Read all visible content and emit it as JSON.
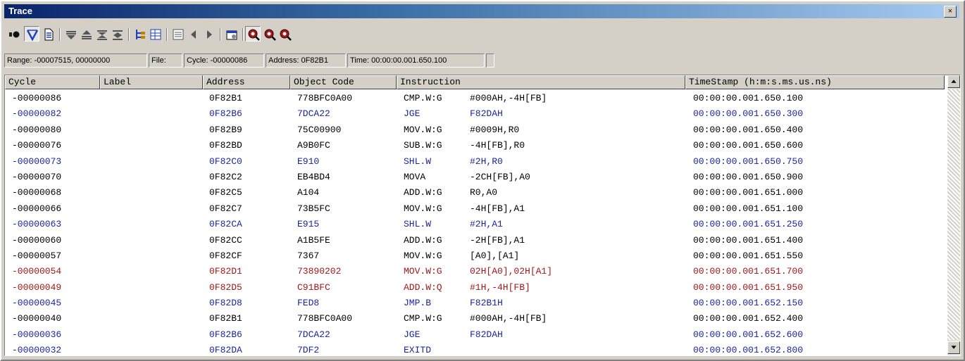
{
  "window": {
    "title": "Trace",
    "close_glyph": "×"
  },
  "toolbar": {
    "buttons": [
      {
        "name": "record-icon"
      },
      {
        "name": "filter-icon"
      },
      {
        "name": "document-icon"
      },
      {
        "name": "step-down-icon"
      },
      {
        "name": "step-up-icon"
      },
      {
        "name": "collapse-icon"
      },
      {
        "name": "expand-icon"
      },
      {
        "name": "tree-icon"
      },
      {
        "name": "grid-icon"
      },
      {
        "name": "window-icon"
      },
      {
        "name": "left-arrow-icon"
      },
      {
        "name": "right-arrow-icon"
      },
      {
        "name": "settings-icon"
      },
      {
        "name": "zoom-in-icon"
      },
      {
        "name": "zoom-out-icon"
      },
      {
        "name": "zoom-reset-icon"
      }
    ]
  },
  "status": {
    "range": "Range: -00007515, 00000000",
    "file": "File:",
    "cycle": "Cycle: -00000086",
    "address": "Address: 0F82B1",
    "time": "Time: 00:00:00.001.650.100"
  },
  "columns": {
    "cycle": "Cycle",
    "label": "Label",
    "address": "Address",
    "object_code": "Object Code",
    "instruction": "Instruction",
    "timestamp": "TimeStamp (h:m:s.ms.us.ns)"
  },
  "colors": {
    "normal": "#000000",
    "blue": "#1a24a0",
    "red": "#a01818"
  },
  "rows": [
    {
      "cycle": "-00000086",
      "label": "",
      "address": "0F82B1",
      "code": "778BFC0A00",
      "mnemonic": "CMP.W:G",
      "operand": "#000AH,-4H[FB]",
      "ts": "00:00:00.001.650.100",
      "color": "black"
    },
    {
      "cycle": "-00000082",
      "label": "",
      "address": "0F82B6",
      "code": "7DCA22",
      "mnemonic": "JGE",
      "operand": "F82DAH",
      "ts": "00:00:00.001.650.300",
      "color": "blue"
    },
    {
      "cycle": "-00000080",
      "label": "",
      "address": "0F82B9",
      "code": "75C00900",
      "mnemonic": "MOV.W:G",
      "operand": "#0009H,R0",
      "ts": "00:00:00.001.650.400",
      "color": "black"
    },
    {
      "cycle": "-00000076",
      "label": "",
      "address": "0F82BD",
      "code": "A9B0FC",
      "mnemonic": "SUB.W:G",
      "operand": "-4H[FB],R0",
      "ts": "00:00:00.001.650.600",
      "color": "black"
    },
    {
      "cycle": "-00000073",
      "label": "",
      "address": "0F82C0",
      "code": "E910",
      "mnemonic": "SHL.W",
      "operand": "#2H,R0",
      "ts": "00:00:00.001.650.750",
      "color": "blue"
    },
    {
      "cycle": "-00000070",
      "label": "",
      "address": "0F82C2",
      "code": "EB4BD4",
      "mnemonic": "MOVA",
      "operand": "-2CH[FB],A0",
      "ts": "00:00:00.001.650.900",
      "color": "black"
    },
    {
      "cycle": "-00000068",
      "label": "",
      "address": "0F82C5",
      "code": "A104",
      "mnemonic": "ADD.W:G",
      "operand": "R0,A0",
      "ts": "00:00:00.001.651.000",
      "color": "black"
    },
    {
      "cycle": "-00000066",
      "label": "",
      "address": "0F82C7",
      "code": "73B5FC",
      "mnemonic": "MOV.W:G",
      "operand": "-4H[FB],A1",
      "ts": "00:00:00.001.651.100",
      "color": "black"
    },
    {
      "cycle": "-00000063",
      "label": "",
      "address": "0F82CA",
      "code": "E915",
      "mnemonic": "SHL.W",
      "operand": "#2H,A1",
      "ts": "00:00:00.001.651.250",
      "color": "blue"
    },
    {
      "cycle": "-00000060",
      "label": "",
      "address": "0F82CC",
      "code": "A1B5FE",
      "mnemonic": "ADD.W:G",
      "operand": "-2H[FB],A1",
      "ts": "00:00:00.001.651.400",
      "color": "black"
    },
    {
      "cycle": "-00000057",
      "label": "",
      "address": "0F82CF",
      "code": "7367",
      "mnemonic": "MOV.W:G",
      "operand": "[A0],[A1]",
      "ts": "00:00:00.001.651.550",
      "color": "black"
    },
    {
      "cycle": "-00000054",
      "label": "",
      "address": "0F82D1",
      "code": "73890202",
      "mnemonic": "MOV.W:G",
      "operand": "02H[A0],02H[A1]",
      "ts": "00:00:00.001.651.700",
      "color": "red"
    },
    {
      "cycle": "-00000049",
      "label": "",
      "address": "0F82D5",
      "code": "C91BFC",
      "mnemonic": "ADD.W:Q",
      "operand": "#1H,-4H[FB]",
      "ts": "00:00:00.001.651.950",
      "color": "red"
    },
    {
      "cycle": "-00000045",
      "label": "",
      "address": "0F82D8",
      "code": "FED8",
      "mnemonic": "JMP.B",
      "operand": "F82B1H",
      "ts": "00:00:00.001.652.150",
      "color": "blue"
    },
    {
      "cycle": "-00000040",
      "label": "",
      "address": "0F82B1",
      "code": "778BFC0A00",
      "mnemonic": "CMP.W:G",
      "operand": "#000AH,-4H[FB]",
      "ts": "00:00:00.001.652.400",
      "color": "black"
    },
    {
      "cycle": "-00000036",
      "label": "",
      "address": "0F82B6",
      "code": "7DCA22",
      "mnemonic": "JGE",
      "operand": "F82DAH",
      "ts": "00:00:00.001.652.600",
      "color": "blue"
    },
    {
      "cycle": "-00000032",
      "label": "",
      "address": "0F82DA",
      "code": "7DF2",
      "mnemonic": "EXITD",
      "operand": "",
      "ts": "00:00:00.001.652.800",
      "color": "blue"
    }
  ]
}
